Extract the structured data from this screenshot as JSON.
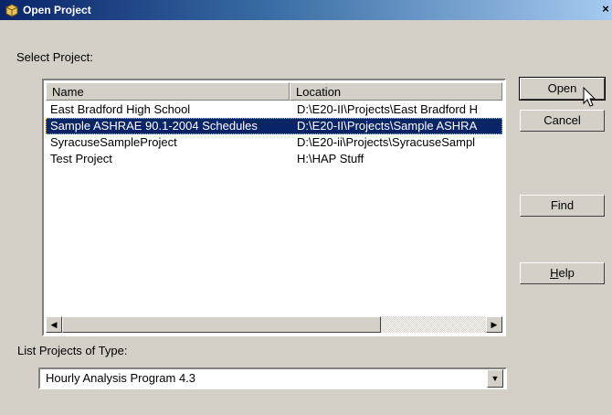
{
  "window": {
    "title": "Open Project",
    "close_glyph": "×"
  },
  "select_label": "Select Project:",
  "columns": [
    "Name",
    "Location"
  ],
  "projects": [
    {
      "name": "East Bradford High School",
      "location": "D:\\E20-II\\Projects\\East Bradford H"
    },
    {
      "name": "Sample ASHRAE 90.1-2004 Schedules",
      "location": "D:\\E20-II\\Projects\\Sample ASHRA"
    },
    {
      "name": "SyracuseSampleProject",
      "location": "D:\\E20-ii\\Projects\\SyracuseSampl"
    },
    {
      "name": "Test Project",
      "location": "H:\\HAP Stuff"
    }
  ],
  "selected_index": 1,
  "buttons": {
    "open": "Open",
    "cancel": "Cancel",
    "find": "Find",
    "help": "Help"
  },
  "type_label": "List Projects of Type:",
  "type_value": "Hourly Analysis Program  4.3",
  "icons": {
    "app": "project-icon",
    "close": "close-icon",
    "scroll_left": "arrow-left-icon",
    "scroll_right": "arrow-right-icon",
    "dropdown": "chevron-down-icon",
    "cursor": "mouse-pointer-icon"
  },
  "colors": {
    "selection": "#0a246a",
    "titlebar_start": "#0a246a",
    "titlebar_end": "#a6caf0",
    "face": "#d4d0c8"
  }
}
